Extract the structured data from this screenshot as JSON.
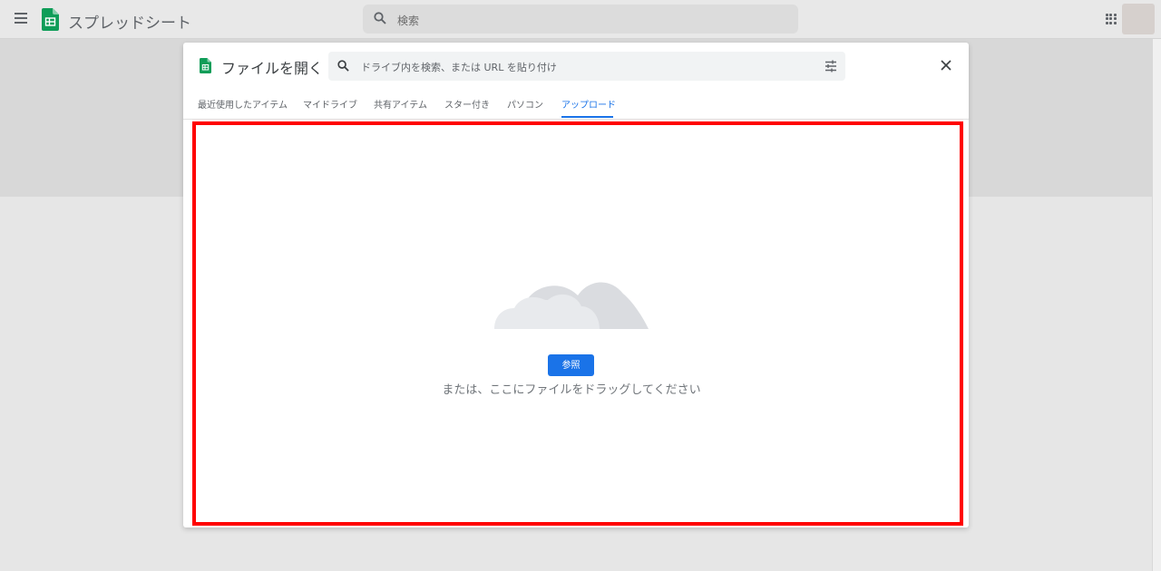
{
  "app": {
    "name": "スプレッドシート",
    "search_placeholder": "検索",
    "brand_color": "#0f9d58"
  },
  "dialog": {
    "title": "ファイルを開く",
    "search_placeholder": "ドライブ内を検索、または URL を貼り付け",
    "tabs": [
      {
        "label": "最近使用したアイテム",
        "active": false
      },
      {
        "label": "マイドライブ",
        "active": false
      },
      {
        "label": "共有アイテム",
        "active": false
      },
      {
        "label": "スター付き",
        "active": false
      },
      {
        "label": "パソコン",
        "active": false
      },
      {
        "label": "アップロード",
        "active": true
      }
    ],
    "upload": {
      "browse_label": "参照",
      "drag_text": "または、ここにファイルをドラッグしてください"
    },
    "accent_color": "#1a73e8",
    "highlight_color": "#ff0000"
  },
  "icons": {
    "menu": "hamburger-menu-icon",
    "search": "search-icon",
    "apps": "apps-grid-icon",
    "close": "close-icon",
    "tune": "tune-icon",
    "cloud": "cloud-illustration"
  }
}
